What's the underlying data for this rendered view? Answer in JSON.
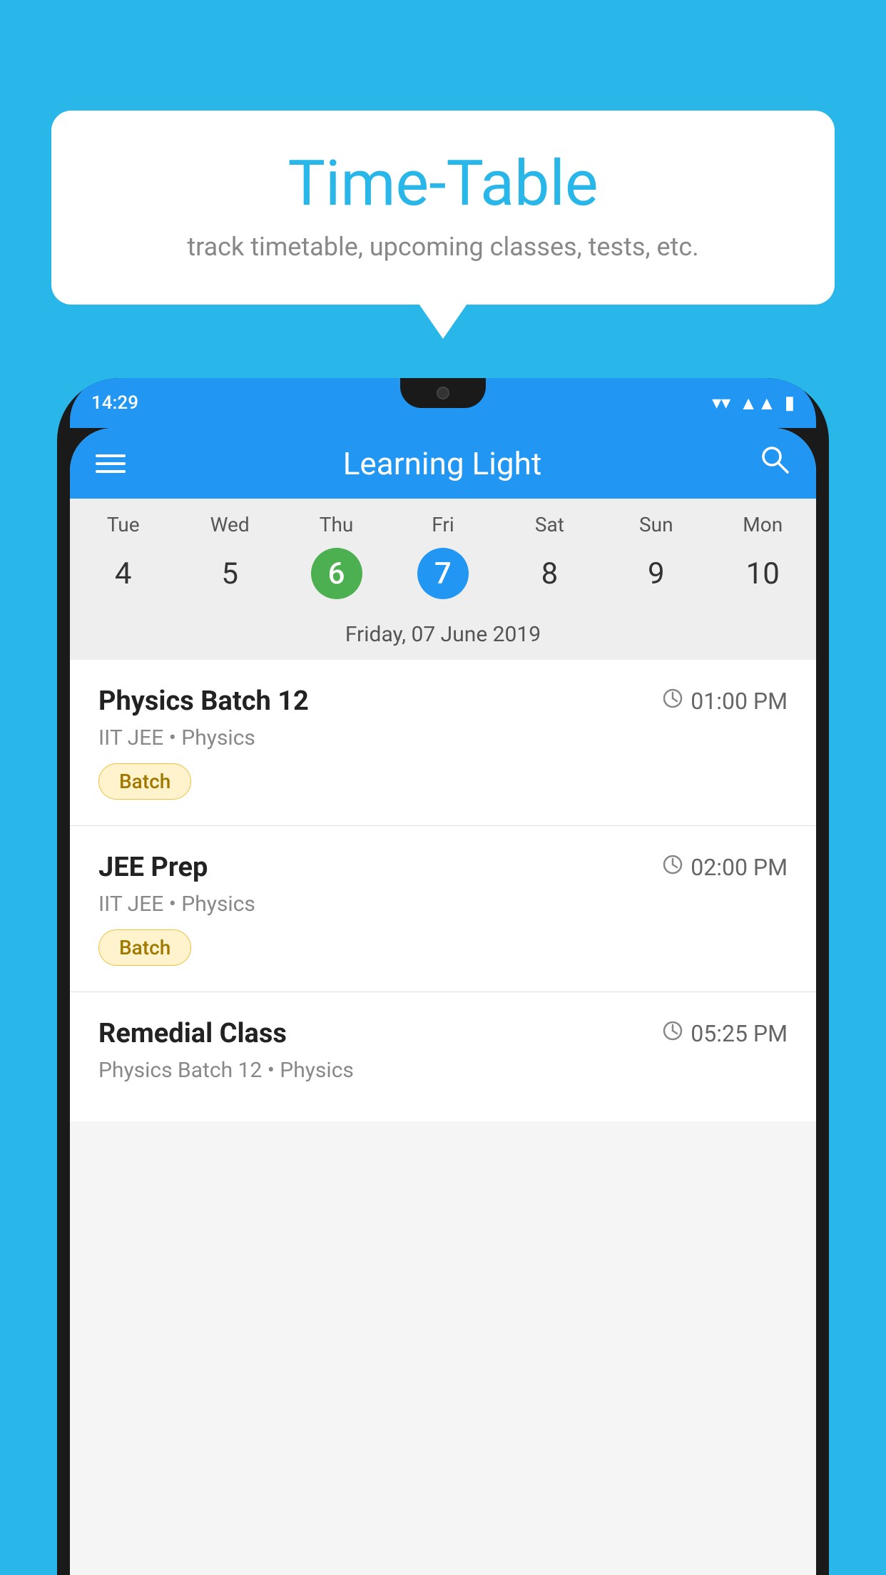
{
  "background_color": "#29B6E8",
  "speech_bubble": {
    "title": "Time-Table",
    "subtitle": "track timetable, upcoming classes, tests, etc."
  },
  "phone": {
    "status_bar": {
      "time": "14:29"
    },
    "app": {
      "title": "Learning Light"
    },
    "calendar": {
      "days_of_week": [
        "Tue",
        "Wed",
        "Thu",
        "Fri",
        "Sat",
        "Sun",
        "Mon"
      ],
      "day_numbers": [
        "4",
        "5",
        "6",
        "7",
        "8",
        "9",
        "10"
      ],
      "selected_today_index": 2,
      "selected_index": 3,
      "selected_date_label": "Friday, 07 June 2019"
    },
    "classes": [
      {
        "title": "Physics Batch 12",
        "time": "01:00 PM",
        "subtitle": "IIT JEE • Physics",
        "tag": "Batch"
      },
      {
        "title": "JEE Prep",
        "time": "02:00 PM",
        "subtitle": "IIT JEE • Physics",
        "tag": "Batch"
      },
      {
        "title": "Remedial Class",
        "time": "05:25 PM",
        "subtitle": "Physics Batch 12 • Physics",
        "tag": ""
      }
    ]
  }
}
